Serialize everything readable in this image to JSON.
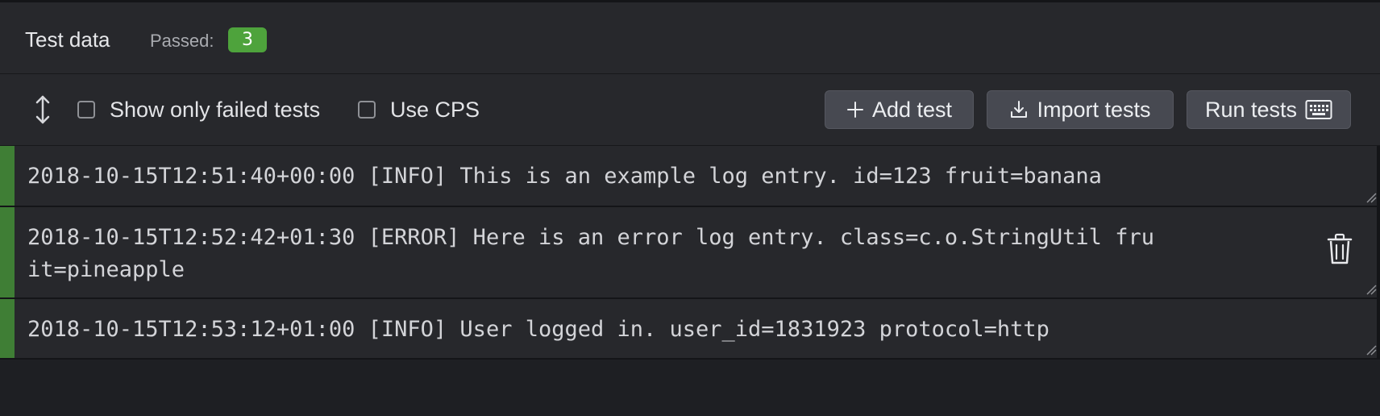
{
  "header": {
    "title": "Test data",
    "passed_label": "Passed:",
    "passed_count": "3"
  },
  "toolbar": {
    "sort_icon": "vertical-resize-icon",
    "show_failed_label": "Show only failed tests",
    "show_failed_checked": false,
    "use_cps_label": "Use CPS",
    "use_cps_checked": false,
    "add_test_label": "Add test",
    "import_tests_label": "Import tests",
    "run_tests_label": "Run tests"
  },
  "tests": [
    {
      "text": "2018-10-15T12:51:40+00:00 [INFO] This is an example log entry. id=123 fruit=banana",
      "status": "passed"
    },
    {
      "text": "2018-10-15T12:52:42+01:30 [ERROR] Here is an error log entry. class=c.o.StringUtil fruit=pineapple",
      "status": "passed"
    },
    {
      "text": "2018-10-15T12:53:12+01:00 [INFO] User logged in. user_id=1831923 protocol=http",
      "status": "passed"
    }
  ],
  "colors": {
    "passed": "#4ea33c",
    "row_bar": "#3f7e35",
    "background": "#1e1f23",
    "panel": "#27282c",
    "button": "#474951"
  }
}
